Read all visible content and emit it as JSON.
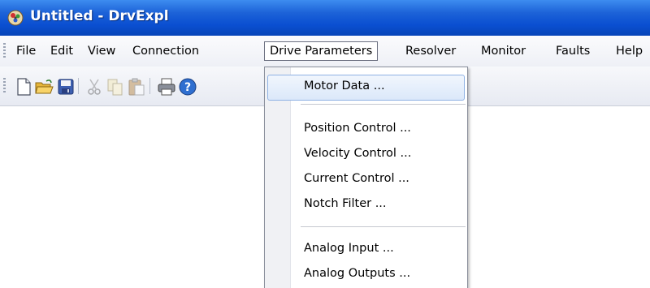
{
  "window": {
    "title": "Untitled - DrvExpl"
  },
  "menubar": {
    "items": [
      {
        "id": "file",
        "label": "File"
      },
      {
        "id": "edit",
        "label": "Edit"
      },
      {
        "id": "view",
        "label": "View"
      },
      {
        "id": "connection",
        "label": "Connection"
      },
      {
        "id": "drive-parameters",
        "label": "Drive Parameters",
        "active": true
      },
      {
        "id": "resolver",
        "label": "Resolver"
      },
      {
        "id": "monitor",
        "label": "Monitor"
      },
      {
        "id": "faults",
        "label": "Faults"
      },
      {
        "id": "help",
        "label": "Help"
      }
    ]
  },
  "toolbar": {
    "buttons": [
      "new-file-icon",
      "open-folder-icon",
      "save-icon",
      "cut-icon",
      "copy-icon",
      "paste-icon",
      "print-icon",
      "help-icon"
    ]
  },
  "dropdown": {
    "items": [
      {
        "label": "Motor Data ...",
        "highlighted": true
      },
      {
        "label": "Position Control ..."
      },
      {
        "label": "Velocity Control ..."
      },
      {
        "label": "Current Control ..."
      },
      {
        "label": "Notch Filter ..."
      },
      {
        "label": "Analog Input ..."
      },
      {
        "label": "Analog Outputs ..."
      }
    ]
  },
  "colors": {
    "title_bar": "#0a4fd1",
    "menu_highlight_border": "#8fb2e4",
    "menu_highlight_fill": "#dbe8fa"
  }
}
